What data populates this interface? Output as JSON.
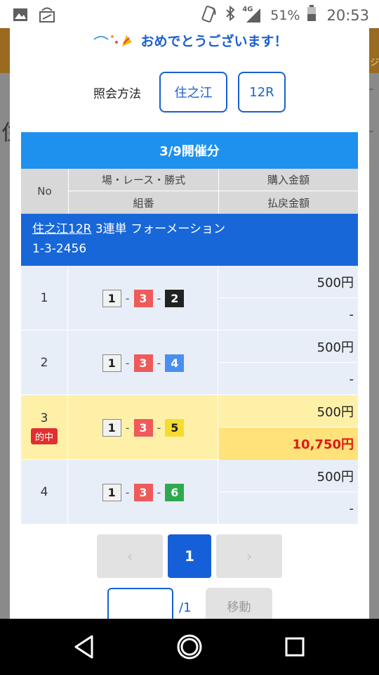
{
  "status_bar": {
    "network": "4G",
    "battery": "51%",
    "time": "20:53"
  },
  "dialog": {
    "congrats": "おめでとうございます！",
    "query_label": "照会方法",
    "venue_chip": "住之江",
    "race_chip": "12R"
  },
  "table": {
    "title": "3/9開催分",
    "headers": {
      "no": "No",
      "race_bet_type": "場・レース・勝式",
      "purchase_amount": "購入金額",
      "combination": "組番",
      "payout_amount": "払戻金額"
    },
    "bet": {
      "venue_race": "住之江12R",
      "bet_type": "3連単 フォーメーション",
      "formation": "1-3-2456"
    },
    "hit_badge": "的中",
    "rows": [
      {
        "no": "1",
        "first": "1",
        "second": "3",
        "third": "2",
        "purchase": "500円",
        "payout": "-"
      },
      {
        "no": "2",
        "first": "1",
        "second": "3",
        "third": "4",
        "purchase": "500円",
        "payout": "-"
      },
      {
        "no": "3",
        "first": "1",
        "second": "3",
        "third": "5",
        "purchase": "500円",
        "payout": "10,750円"
      },
      {
        "no": "4",
        "first": "1",
        "second": "3",
        "third": "6",
        "purchase": "500円",
        "payout": "-"
      }
    ]
  },
  "pagination": {
    "prev_icon": "‹",
    "current": "1",
    "next_icon": "›",
    "total_label": "/1",
    "move_button": "移動"
  },
  "colors": {
    "accent_blue": "#1560d8",
    "title_blue": "#1e90ee",
    "hit_yellow": "#fff0a8",
    "payout_red": "#e01818"
  }
}
